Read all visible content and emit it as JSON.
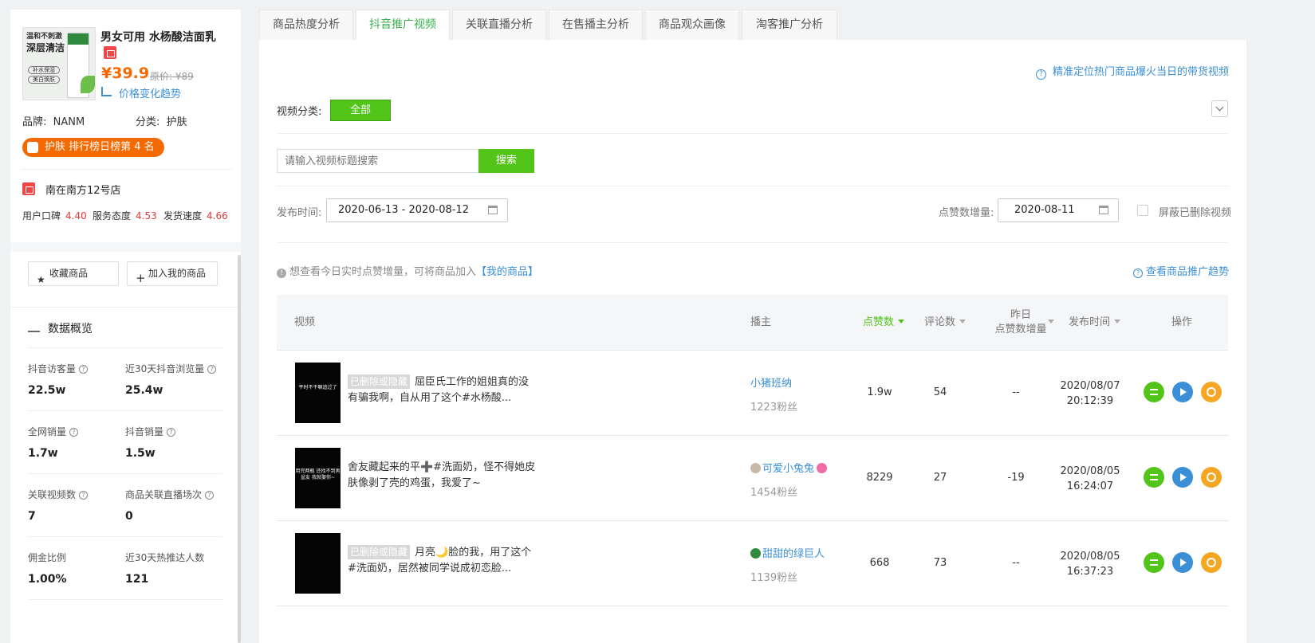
{
  "product": {
    "image_text_1": "温和不刺激",
    "image_text_2": "深层清洁",
    "image_pill_1": "补水保湿",
    "image_pill_2": "美白焕肤",
    "title": "男女可用 水杨酸洁面乳",
    "price": "¥39.9",
    "original_price": "原价: ¥89",
    "price_trend": "价格变化趋势",
    "brand_label": "品牌:",
    "brand": "NANM",
    "category_label": "分类:",
    "category": "护肤",
    "rank_badge": "护肤 排行榜日榜第 4 名"
  },
  "store": {
    "name": "南在南方12号店",
    "scores": [
      {
        "label": "用户口碑",
        "value": "4.40"
      },
      {
        "label": "服务态度",
        "value": "4.53"
      },
      {
        "label": "发货速度",
        "value": "4.66"
      }
    ]
  },
  "actions": {
    "favorite": "收藏商品",
    "add_mine": "加入我的商品"
  },
  "overview": {
    "title": "数据概览",
    "stats": [
      {
        "label": "抖音访客量",
        "value": "22.5w"
      },
      {
        "label": "近30天抖音浏览量",
        "value": "25.4w"
      },
      {
        "label": "全网销量",
        "value": "1.7w"
      },
      {
        "label": "抖音销量",
        "value": "1.5w"
      },
      {
        "label": "关联视频数",
        "value": "7"
      },
      {
        "label": "商品关联直播场次",
        "value": "0"
      },
      {
        "label": "佣金比例",
        "value": "1.00%"
      },
      {
        "label": "近30天热推达人数",
        "value": "121"
      }
    ]
  },
  "tabs": [
    "商品热度分析",
    "抖音推广视频",
    "关联直播分析",
    "在售播主分析",
    "商品观众画像",
    "淘客推广分析"
  ],
  "hint_top": "精准定位热门商品爆火当日的带货视频",
  "filter": {
    "category_label": "视频分类:",
    "category_all": "全部",
    "search_placeholder": "请输入视频标题搜索",
    "search_button": "搜索",
    "date_label": "发布时间:",
    "date_range": "2020-06-13 - 2020-08-12",
    "likes_label": "点赞数增量:",
    "likes_date": "2020-08-11",
    "hide_deleted": "屏蔽已删除视频"
  },
  "info": {
    "text": "想查看今日实时点赞增量，可将商品加入",
    "link": "【我的商品】",
    "trend_link": "查看商品推广趋势"
  },
  "table": {
    "headers": {
      "video": "视频",
      "anchor": "播主",
      "likes": "点赞数",
      "comments": "评论数",
      "yesterday_1": "昨日",
      "yesterday_2": "点赞数增量",
      "publish_time": "发布时间",
      "ops": "操作"
    },
    "deleted_tag": "已删除或隐藏",
    "rows": [
      {
        "thumb_text": "平时不干嘛追过了",
        "title": "屈臣氏工作的姐姐真的没有骗我啊，自从用了这个#水杨酸...",
        "deleted": true,
        "anchor": "小猪班纳",
        "fans": "1223粉丝",
        "likes": "1.9w",
        "comments": "54",
        "yesterday": "--",
        "date": "2020/08/07",
        "time": "20:12:39"
      },
      {
        "thumb_text": "用完两瓶 还找不到男盆友 我就娶你~",
        "title": "舍友藏起来的平➕#洗面奶，怪不得她皮肤像剥了壳的鸡蛋，我爱了~",
        "deleted": false,
        "anchor": "可爱小兔兔",
        "fans": "1454粉丝",
        "likes": "8229",
        "comments": "27",
        "yesterday": "-19",
        "date": "2020/08/05",
        "time": "16:24:07"
      },
      {
        "thumb_text": "",
        "title": "月亮🌙脸的我，用了这个#洗面奶，居然被同学说成初恋脸...",
        "deleted": true,
        "anchor": "甜甜的绿巨人",
        "fans": "1139粉丝",
        "likes": "668",
        "comments": "73",
        "yesterday": "--",
        "date": "2020/08/05",
        "time": "16:37:23"
      }
    ]
  },
  "colors": {
    "green": "#52c41a",
    "blue": "#3b8fd6",
    "orange": "#f56a00",
    "red": "#e23b3b"
  }
}
